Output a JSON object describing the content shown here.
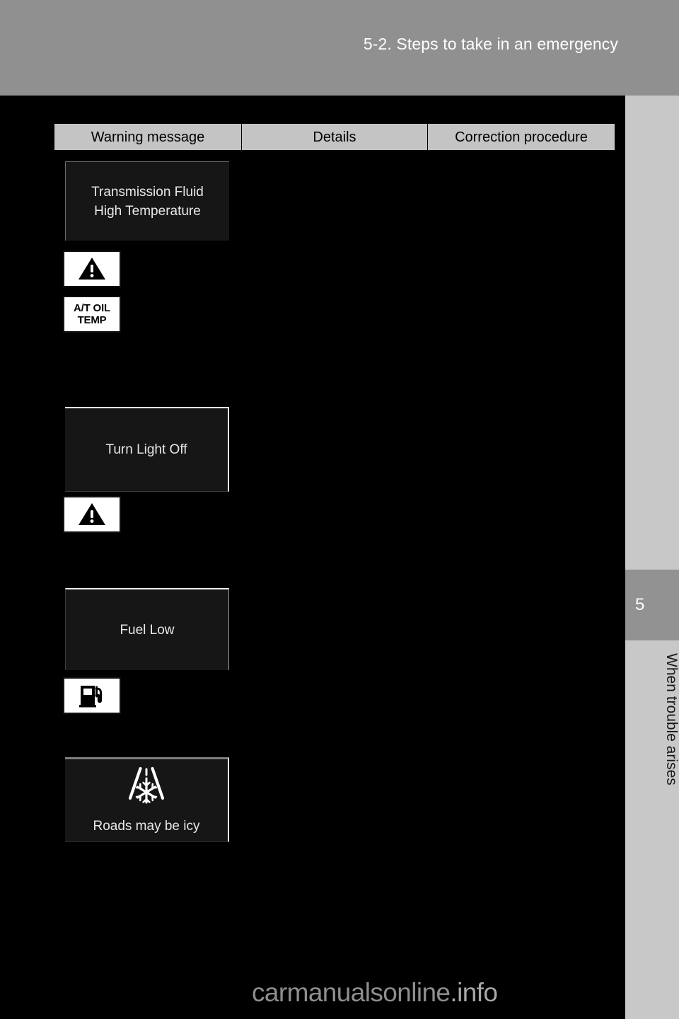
{
  "header": {
    "title": "5-2. Steps to take in an emergency"
  },
  "sidebar": {
    "chapter_number": "5",
    "section_label": "When trouble arises"
  },
  "table": {
    "columns": [
      {
        "label": "Warning message"
      },
      {
        "label": "Details"
      },
      {
        "label": "Correction procedure"
      }
    ],
    "rows": [
      {
        "message_lines": [
          "Transmission Fluid",
          "High Temperature"
        ],
        "icons": [
          "warning-triangle-icon",
          "at-oil-temp-icon"
        ],
        "icon_labels": [
          "",
          "A/T OIL\nTEMP"
        ],
        "details": "",
        "correction": ""
      },
      {
        "message_lines": [
          "Turn Light Off"
        ],
        "icons": [
          "warning-triangle-icon"
        ],
        "icon_labels": [
          ""
        ],
        "details": "",
        "correction": ""
      },
      {
        "message_lines": [
          "Fuel Low"
        ],
        "icons": [
          "fuel-pump-icon"
        ],
        "icon_labels": [
          ""
        ],
        "details": "",
        "correction": ""
      },
      {
        "message_lines": [
          "Roads may be icy"
        ],
        "icons": [
          "icy-road-icon"
        ],
        "icon_labels": [
          ""
        ],
        "details": "",
        "correction": ""
      }
    ]
  },
  "icon_text": {
    "at_oil_line1": "A/T OIL",
    "at_oil_line2": "TEMP"
  },
  "watermark": {
    "dark_part": "carmanualsonline",
    "light_part": ".info"
  },
  "colors": {
    "header_band": "#909090",
    "content_background": "#000000",
    "sidebar": "#c8c8c8",
    "chapter_block": "#929292",
    "table_header": "#c4c4c4",
    "message_box": "#161616"
  }
}
